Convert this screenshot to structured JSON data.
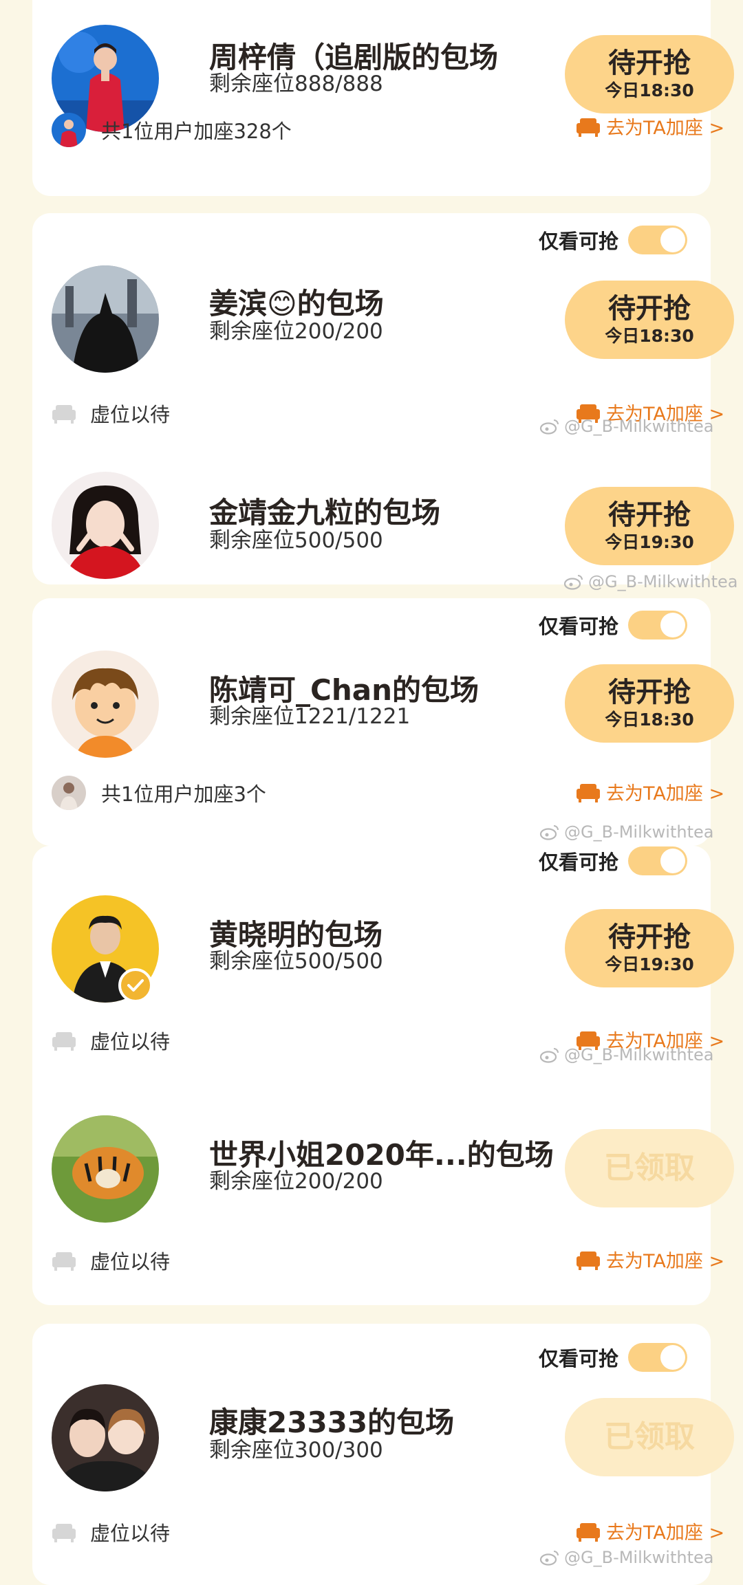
{
  "toggle_label": "仅看可抢",
  "add_seat_label": "去为TA加座 >",
  "empty_seats_label": "虚位以待",
  "watermark": "@G_B-Milkwithtea",
  "items": [
    {
      "title": "周梓倩（追剧版的包场",
      "seats": "剩余座位888/888",
      "button_main": "待开抢",
      "button_sub": "今日18:30",
      "added": "共1位用户加座328个"
    },
    {
      "title": "姜滨😊的包场",
      "seats": "剩余座位200/200",
      "button_main": "待开抢",
      "button_sub": "今日18:30"
    },
    {
      "title": "金靖金九粒的包场",
      "seats": "剩余座位500/500",
      "button_main": "待开抢",
      "button_sub": "今日19:30"
    },
    {
      "title": "陈靖可_Chan的包场",
      "seats": "剩余座位1221/1221",
      "button_main": "待开抢",
      "button_sub": "今日18:30",
      "added": "共1位用户加座3个"
    },
    {
      "title": "黄晓明的包场",
      "seats": "剩余座位500/500",
      "button_main": "待开抢",
      "button_sub": "今日19:30"
    },
    {
      "title": "世界小姐2020年...的包场",
      "seats": "剩余座位200/200",
      "button_main": "已领取"
    },
    {
      "title": "康康23333的包场",
      "seats": "剩余座位300/300",
      "button_main": "已领取"
    }
  ],
  "colors": {
    "accent": "#e8791c",
    "button": "#fdd48a",
    "button_done": "#fdecc6",
    "toggle": "#fcd184",
    "background": "#fbf7e6"
  }
}
